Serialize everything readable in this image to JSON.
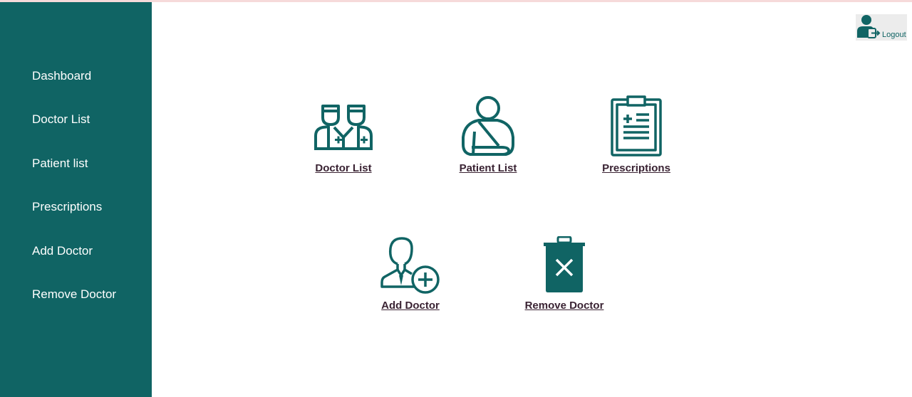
{
  "colors": {
    "brand": "#106464",
    "label": "#3a2333",
    "logout_bg": "#ececec"
  },
  "sidebar": {
    "items": [
      {
        "label": "Dashboard"
      },
      {
        "label": "Doctor List"
      },
      {
        "label": "Patient list"
      },
      {
        "label": "Prescriptions"
      },
      {
        "label": "Add Doctor"
      },
      {
        "label": "Remove Doctor"
      }
    ]
  },
  "header": {
    "logout_label": "Logout",
    "logout_icon": "user-logout-icon"
  },
  "tiles": [
    {
      "label": "Doctor List",
      "icon": "doctors-icon"
    },
    {
      "label": "Patient List",
      "icon": "patient-icon"
    },
    {
      "label": "Prescriptions",
      "icon": "clipboard-icon"
    },
    {
      "label": "Add Doctor",
      "icon": "add-doctor-icon"
    },
    {
      "label": "Remove Doctor",
      "icon": "trash-icon"
    }
  ]
}
